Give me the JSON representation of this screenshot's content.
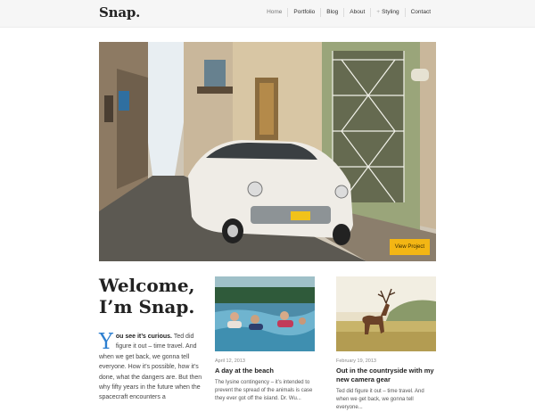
{
  "brand": {
    "logo": "Snap."
  },
  "nav": {
    "items": [
      "Home",
      "Portfolio",
      "Blog",
      "About",
      "Styling",
      "Contact"
    ]
  },
  "hero": {
    "button_label": "View Project"
  },
  "welcome": {
    "title_line1": "Welcome,",
    "title_line2": "I’m Snap.",
    "dropcap": "Y",
    "lead": "ou see it’s curious.",
    "body": " Ted did figure it out – time travel. And when we get back, we gonna tell everyone. How it’s possible, how it’s done, what the dangers are. But then why fifty years in the future when the spacecraft encounters a"
  },
  "posts": [
    {
      "date": "April 12, 2013",
      "title": "A day at the beach",
      "excerpt": "The lysine contingency – it’s intended to prevent the spread of the animals is case they ever got off the island. Dr. Wu..."
    },
    {
      "date": "February 19, 2013",
      "title": "Out in the countryside with my new camera gear",
      "excerpt": "Ted did figure it out – time travel. And when we get back, we gonna tell everyone..."
    }
  ],
  "colors": {
    "accent_button": "#f3b614",
    "dropcap": "#2d7fd0",
    "header_bg": "#f6f6f6"
  }
}
